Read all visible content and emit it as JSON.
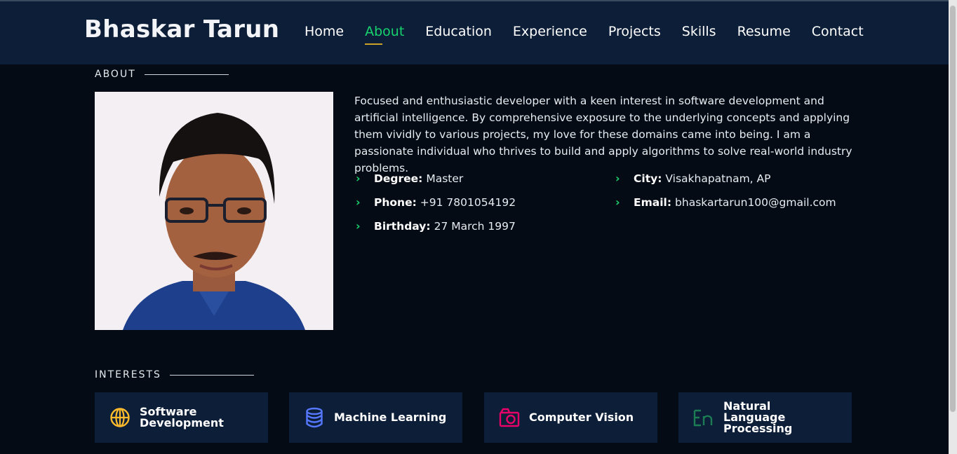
{
  "header": {
    "logo": "Bhaskar Tarun",
    "nav": [
      "Home",
      "About",
      "Education",
      "Experience",
      "Projects",
      "Skills",
      "Resume",
      "Contact"
    ],
    "active": "About"
  },
  "about": {
    "section_title": "ABOUT",
    "photo_alt": "Profile photo",
    "paragraph": "Focused and enthusiastic developer with a keen interest in software development and artificial intelligence. By comprehensive exposure to the underlying concepts and applying them vividly to various projects, my love for these domains came into being. I am a passionate individual who thrives to build and apply algorithms to solve real-world industry problems.",
    "info": {
      "degree_label": "Degree:",
      "degree": "Master",
      "phone_label": "Phone:",
      "phone": "+91 7801054192",
      "birthday_label": "Birthday:",
      "birthday": "27 March 1997",
      "city_label": "City:",
      "city": "Visakhapatnam, AP",
      "email_label": "Email:",
      "email": "bhaskartarun100@gmail.com"
    }
  },
  "interests": {
    "section_title": "INTERESTS",
    "items": [
      {
        "label": "Software Development",
        "icon": "globe-icon",
        "color": "#ffbb2c"
      },
      {
        "label": "Machine Learning",
        "icon": "database-icon",
        "color": "#5578ff"
      },
      {
        "label": "Computer Vision",
        "icon": "camera-icon",
        "color": "#e80368"
      },
      {
        "label": "Natural Language Processing",
        "icon": "language-icon",
        "color": "#1c7c54"
      }
    ]
  },
  "colors": {
    "accent": "#18d26e",
    "header_bg": "#0c1e38",
    "page_bg": "#040b14",
    "underline": "#c9a227"
  }
}
